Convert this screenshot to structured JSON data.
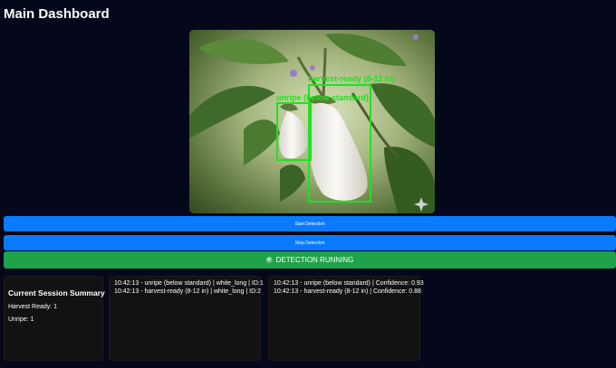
{
  "header": {
    "title": "Main Dashboard"
  },
  "feed": {
    "detections": [
      {
        "label": "unripe (below standard)"
      },
      {
        "label": "harvest-ready (8-12 in)"
      }
    ],
    "accent_color": "#22e022"
  },
  "controls": {
    "start_label": "Start Detection",
    "stop_label": "Stop Detection",
    "status_label": "DETECTION RUNNING",
    "status_icon": "status-dot-icon",
    "button_color": "#0a7bff",
    "status_color": "#1fa24a"
  },
  "summary": {
    "title": "Current Session Summary",
    "harvest_ready": "Harvest Ready: 1",
    "unripe": "Unripe: 1"
  },
  "detection_log": [
    "10:42:13 - unripe (below standard) | white_long | ID:1",
    "10:42:13 - harvest-ready (8-12 in) | white_long | ID:2"
  ],
  "confidence_log": [
    "10:42:13 - unripe (below standard) | Confidence: 0.93",
    "10:42:13 - harvest-ready (8-12 in) | Confidence: 0.88"
  ]
}
